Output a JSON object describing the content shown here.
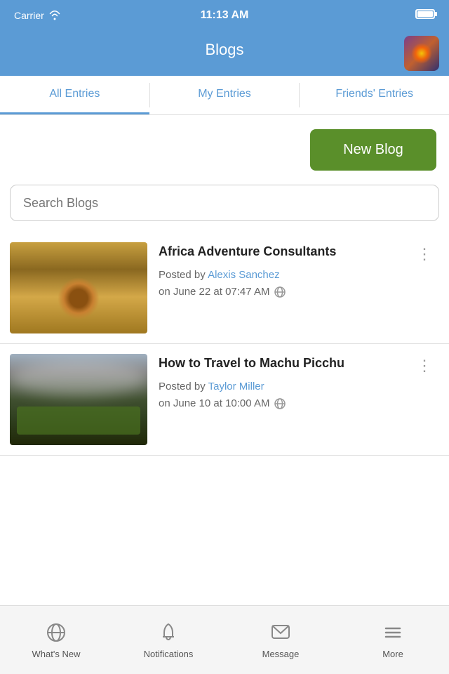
{
  "statusBar": {
    "carrier": "Carrier",
    "time": "11:13 AM"
  },
  "header": {
    "title": "Blogs"
  },
  "tabs": [
    {
      "label": "All Entries",
      "active": true
    },
    {
      "label": "My Entries",
      "active": false
    },
    {
      "label": "Friends' Entries",
      "active": false
    }
  ],
  "newBlogButton": {
    "label": "New Blog"
  },
  "search": {
    "placeholder": "Search Blogs"
  },
  "blogPosts": [
    {
      "title": "Africa Adventure Consultants",
      "postedBy": "Posted by",
      "author": "Alexis Sanchez",
      "date": "on June 22 at 07:47 AM",
      "thumb": "lion"
    },
    {
      "title": "How to Travel to Machu Picchu",
      "postedBy": "Posted by",
      "author": "Taylor Miller",
      "date": "on June 10 at 10:00 AM",
      "thumb": "machu"
    }
  ],
  "bottomBar": {
    "tabs": [
      {
        "label": "What's New",
        "icon": "globe"
      },
      {
        "label": "Notifications",
        "icon": "bell"
      },
      {
        "label": "Message",
        "icon": "message"
      },
      {
        "label": "More",
        "icon": "menu"
      }
    ]
  }
}
